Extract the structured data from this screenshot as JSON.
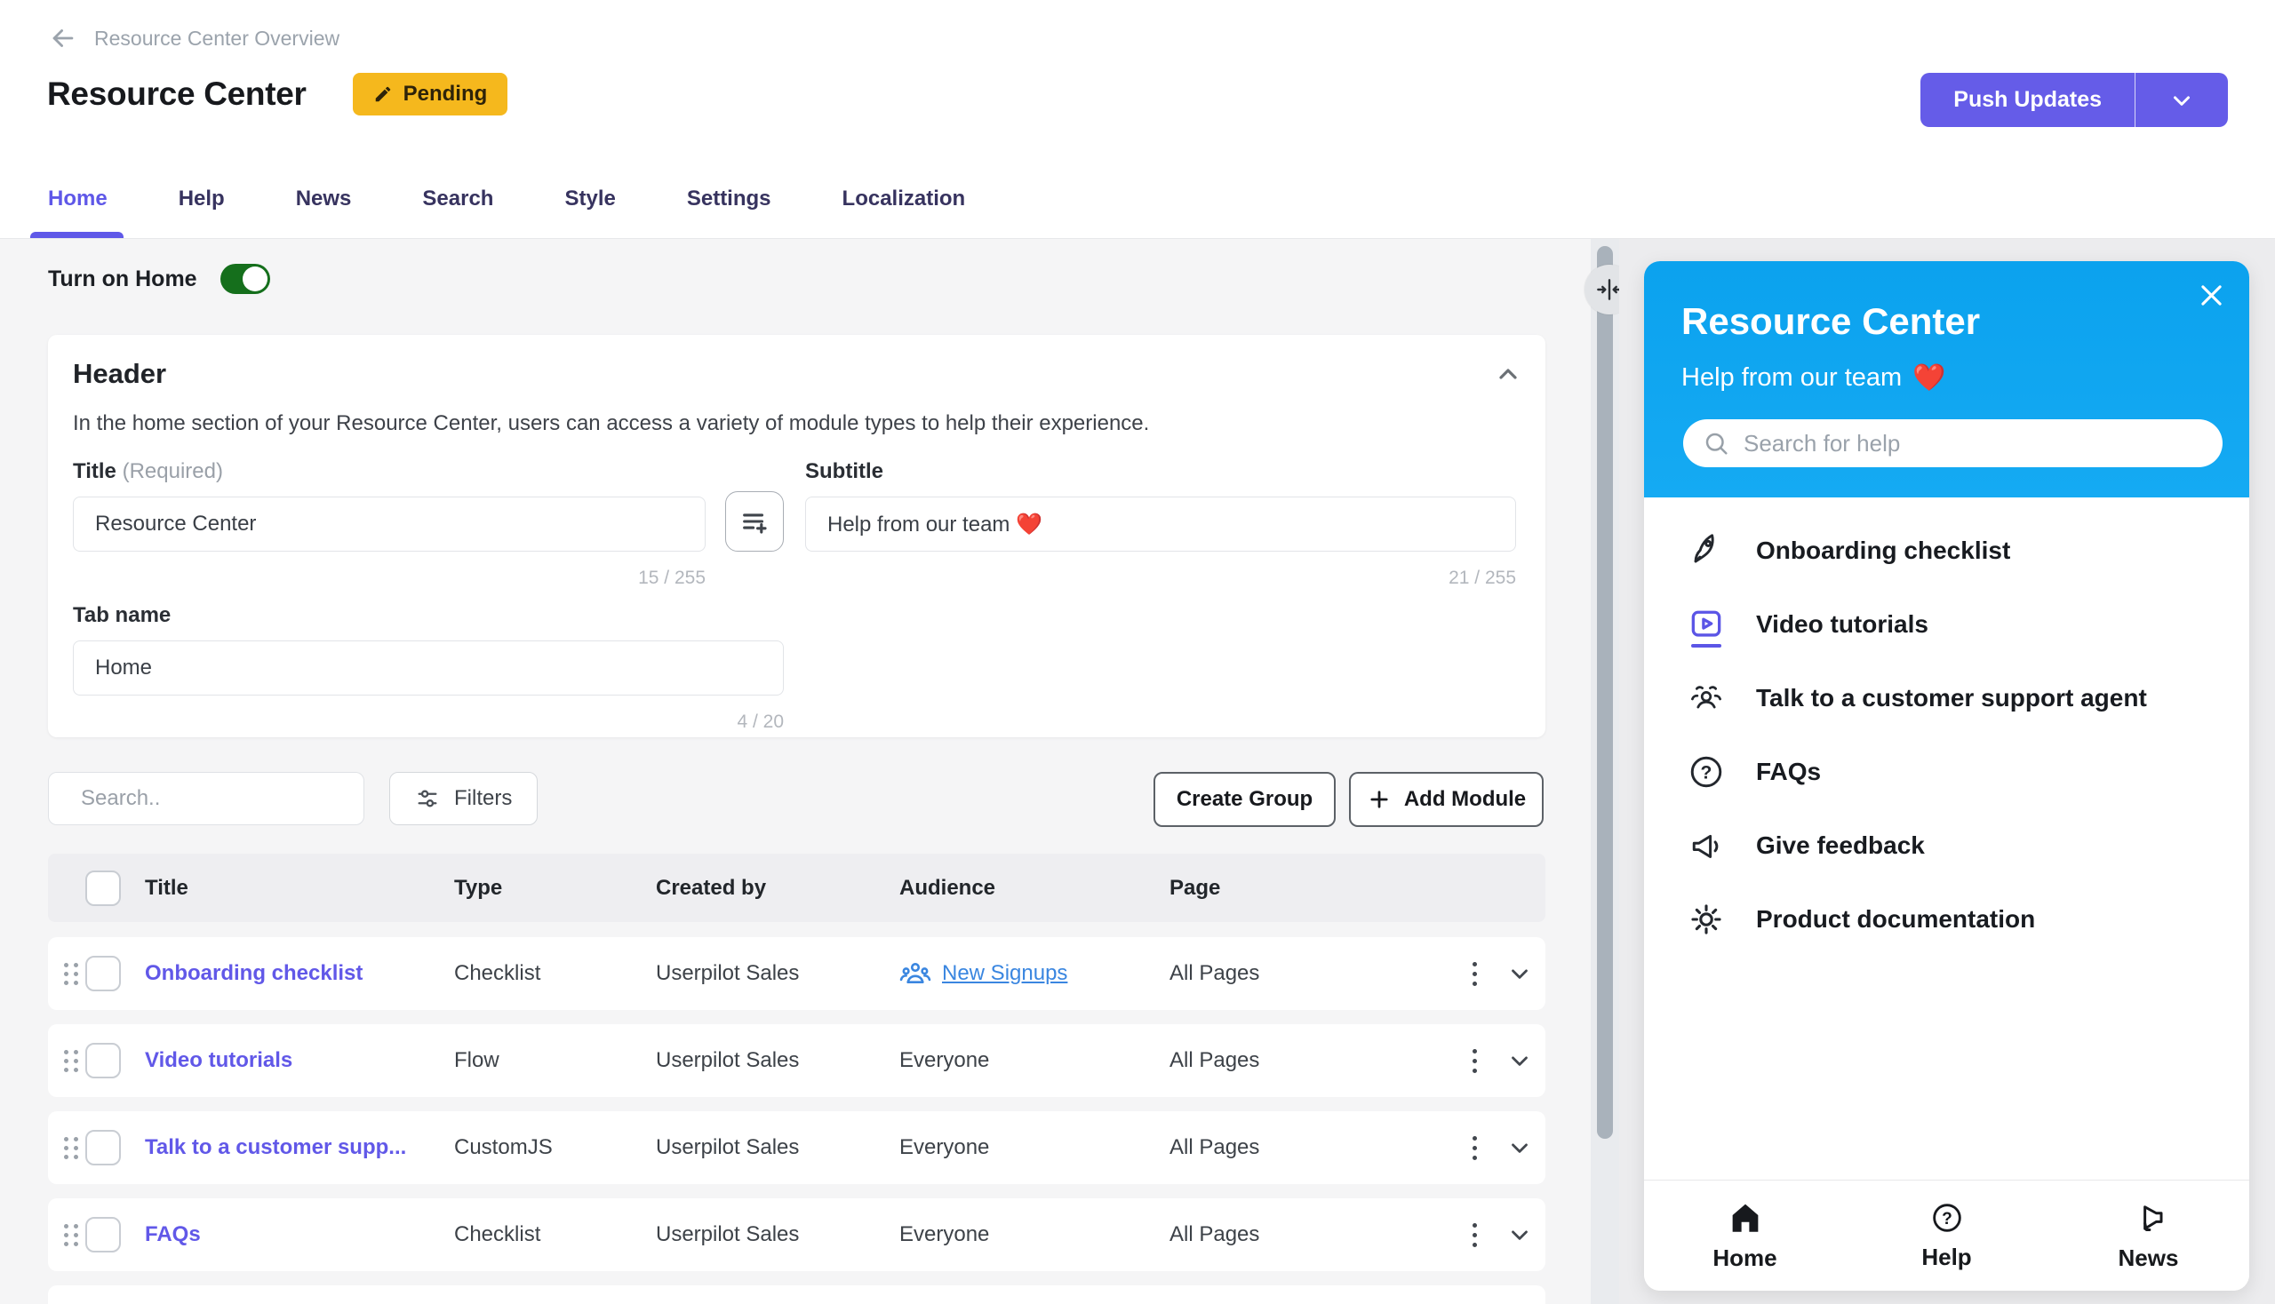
{
  "topbar": {
    "breadcrumb": "Resource Center Overview",
    "title": "Resource Center",
    "badge": "Pending",
    "push_updates": "Push Updates"
  },
  "tabs": {
    "active": "Home",
    "items": [
      "Home",
      "Help",
      "News",
      "Search",
      "Style",
      "Settings",
      "Localization"
    ]
  },
  "home_toggle": {
    "label": "Turn on Home",
    "state": "on"
  },
  "header_card": {
    "title": "Header",
    "description": "In the home section of your Resource Center, users can access a variety of module types to help their experience.",
    "title_field": {
      "label": "Title",
      "required_hint": "(Required)",
      "value": "Resource Center",
      "counter": "15 / 255"
    },
    "subtitle_field": {
      "label": "Subtitle",
      "value": "Help from our team ❤️",
      "counter": "21 / 255"
    },
    "tab_name_field": {
      "label": "Tab name",
      "value": "Home",
      "counter": "4 / 20"
    }
  },
  "toolbar": {
    "search_placeholder": "Search..",
    "filters_label": "Filters",
    "create_group_label": "Create Group",
    "add_module_label": "Add Module"
  },
  "modules_table": {
    "columns": {
      "title": "Title",
      "type": "Type",
      "created_by": "Created by",
      "audience": "Audience",
      "page": "Page"
    },
    "rows": [
      {
        "title": "Onboarding checklist",
        "type": "Checklist",
        "created_by": "Userpilot Sales",
        "audience": "New Signups",
        "audience_icon": "users-icon",
        "page": "All Pages"
      },
      {
        "title": "Video tutorials",
        "type": "Flow",
        "created_by": "Userpilot Sales",
        "audience": "Everyone",
        "page": "All Pages"
      },
      {
        "title": "Talk to a customer supp...",
        "type": "CustomJS",
        "created_by": "Userpilot Sales",
        "audience": "Everyone",
        "page": "All Pages"
      },
      {
        "title": "FAQs",
        "type": "Checklist",
        "created_by": "Userpilot Sales",
        "audience": "Everyone",
        "page": "All Pages"
      }
    ]
  },
  "preview": {
    "title": "Resource Center",
    "subtitle": "Help from our team",
    "subtitle_heart": "❤️",
    "search_placeholder": "Search for help",
    "modules": [
      {
        "icon": "rocket-icon",
        "label": "Onboarding checklist"
      },
      {
        "icon": "video-play-icon",
        "label": "Video tutorials"
      },
      {
        "icon": "people-group-icon",
        "label": "Talk to a customer support agent"
      },
      {
        "icon": "question-circle-icon",
        "label": "FAQs"
      },
      {
        "icon": "megaphone-icon",
        "label": "Give feedback"
      },
      {
        "icon": "gear-icon",
        "label": "Product documentation"
      }
    ],
    "bottom_nav": [
      {
        "icon": "home-icon",
        "label": "Home",
        "active": true
      },
      {
        "icon": "question-circle-icon",
        "label": "Help",
        "active": false
      },
      {
        "icon": "megaphone-icon",
        "label": "News",
        "active": false
      }
    ]
  },
  "colors": {
    "accent_indigo": "#655ce8",
    "active_tab": "#5f58e8",
    "badge_amber": "#f5b81d",
    "toggle_green": "#156f1c",
    "panel_blue": "#0da6f1",
    "link_blue": "#3a86e0",
    "row_link": "#6158e8"
  }
}
